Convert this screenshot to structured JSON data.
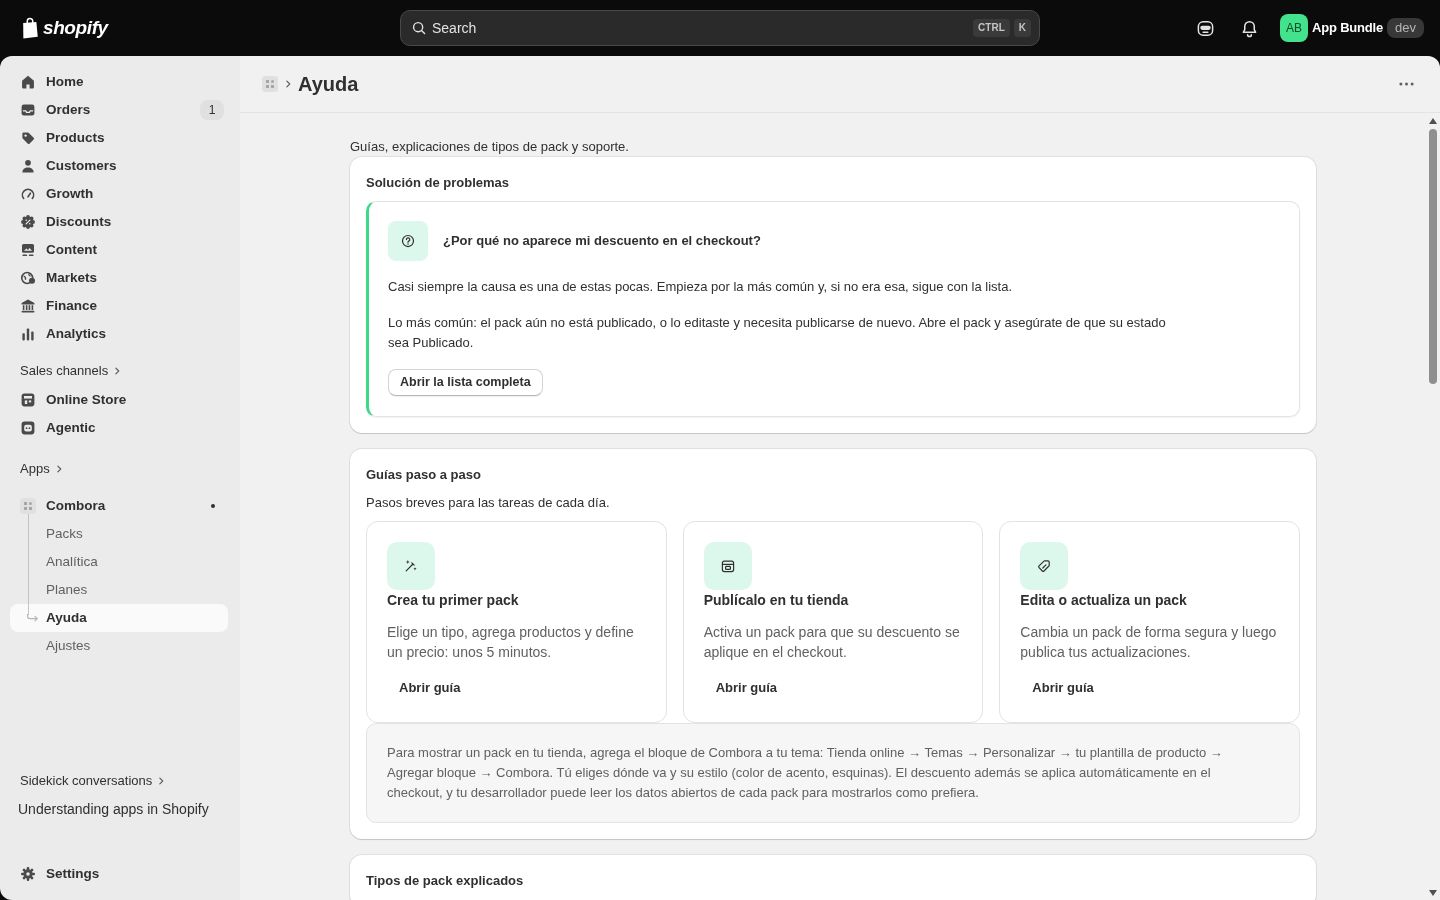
{
  "topbar": {
    "logo": "shopify",
    "search": {
      "placeholder": "Search",
      "shortcut": [
        "CTRL",
        "K"
      ]
    },
    "account": {
      "initials": "AB",
      "name": "App Bundle",
      "tag": "dev"
    }
  },
  "sidebar": {
    "nav": [
      {
        "label": "Home",
        "selected": false
      },
      {
        "label": "Orders",
        "count": "1",
        "selected": false
      },
      {
        "label": "Products",
        "selected": false
      },
      {
        "label": "Customers",
        "selected": false
      },
      {
        "label": "Growth",
        "selected": false
      },
      {
        "label": "Discounts",
        "selected": false
      },
      {
        "label": "Content",
        "selected": false
      },
      {
        "label": "Markets",
        "selected": false
      },
      {
        "label": "Finance",
        "selected": false
      },
      {
        "label": "Analytics",
        "selected": false
      }
    ],
    "sales_channels": {
      "title": "Sales channels",
      "items": [
        {
          "label": "Online Store",
          "selected": false
        },
        {
          "label": "Agentic",
          "selected": false
        }
      ]
    },
    "apps": {
      "title": "Apps",
      "items": [
        {
          "label": "Combora",
          "children": [
            {
              "label": "Packs",
              "selected": false
            },
            {
              "label": "Analítica",
              "selected": false
            },
            {
              "label": "Planes",
              "selected": false
            },
            {
              "label": "Ayuda",
              "selected": true
            },
            {
              "label": "Ajustes",
              "selected": false
            }
          ]
        }
      ]
    },
    "sidekick": {
      "title": "Sidekick conversations",
      "items": [
        {
          "label": "Understanding apps in Shopify"
        }
      ]
    },
    "settings": {
      "label": "Settings"
    }
  },
  "page": {
    "title": "Ayuda",
    "intro": "Guías, explicaciones de tipos de pack y soporte."
  },
  "troubleshooting": {
    "title": "Solución de problemas",
    "question": "¿Por qué no aparece mi descuento en el checkout?",
    "paragraphs": [
      "Casi siempre la causa es una de estas pocas. Empieza por la más común y, si no era esa, sigue con la lista.",
      "Lo más común: el pack aún no está publicado, o lo editaste y necesita publicarse de nuevo. Abre el pack y asegúrate de que su estado sea Publicado."
    ],
    "button": "Abrir la lista completa"
  },
  "guides": {
    "title": "Guías paso a paso",
    "subtitle": "Pasos breves para las tareas de cada día.",
    "items": [
      {
        "title": "Crea tu primer pack",
        "description": "Elige un tipo, agrega productos y define un precio: unos 5 minutos.",
        "button": "Abrir guía"
      },
      {
        "title": "Publícalo en tu tienda",
        "description": "Activa un pack para que su descuento se aplique en el checkout.",
        "button": "Abrir guía"
      },
      {
        "title": "Edita o actualiza un pack",
        "description": "Cambia un pack de forma segura y luego publica tus actualizaciones.",
        "button": "Abrir guía"
      }
    ],
    "note": "Para mostrar un pack en tu tienda, agrega el bloque de Combora a tu tema: Tienda online → Temas → Personalizar → tu plantilla de producto → Agregar bloque → Combora. Tú eliges dónde va y su estilo (color de acento, esquinas). El descuento además se aplica automáticamente en el checkout, y tu desarrollador puede leer los datos abiertos de cada pack para mostrarlos como prefiera."
  },
  "pack_types": {
    "title": "Tipos de pack explicados"
  }
}
